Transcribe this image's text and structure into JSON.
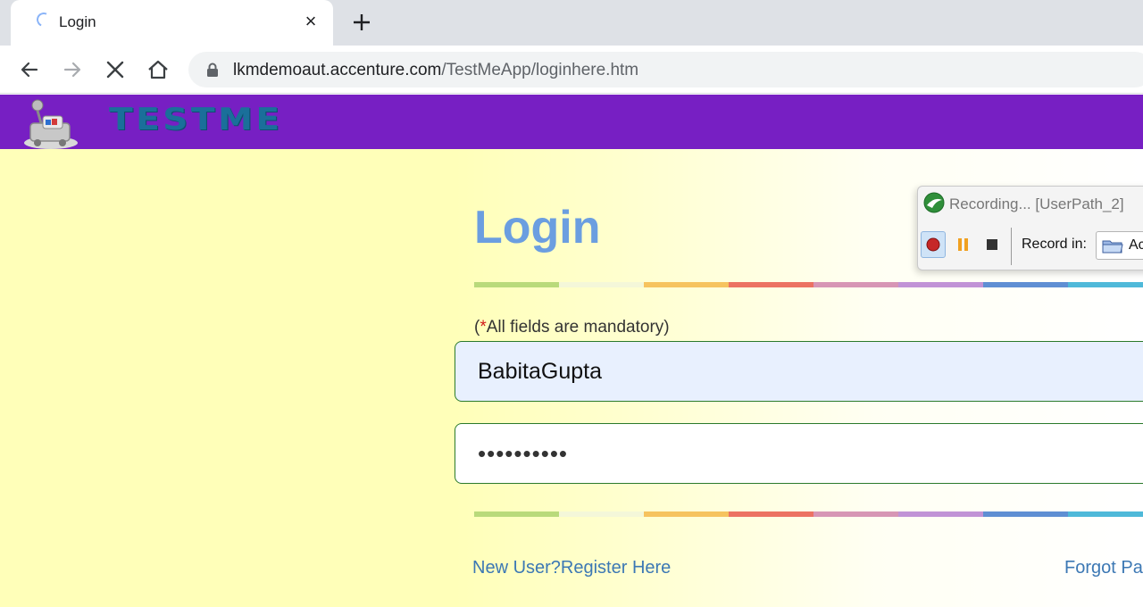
{
  "browser": {
    "tab_title": "Login",
    "tab_close": "×",
    "url_host": "lkmdemoaut.accenture.com",
    "url_path": "/TestMeApp/loginhere.htm"
  },
  "header": {
    "logo_text": "TESTME"
  },
  "login": {
    "title": "Login",
    "mandatory_open": "(",
    "mandatory_star": "*",
    "mandatory_rest": "All fields are mandatory)",
    "username_value": "BabitaGupta",
    "password_mask": "••••••••••",
    "register_link": "New User?Register Here",
    "forgot_link": "Forgot Pa"
  },
  "rainbow_colors": [
    "#b9da7b",
    "#f4f7d9",
    "#f6c35f",
    "#ec7263",
    "#d796b5",
    "#c193d6",
    "#5f8fd3",
    "#4fb9d9"
  ],
  "recorder": {
    "title": "Recording... [UserPath_2]",
    "record_in_label": "Record in:",
    "record_in_value": "Ac"
  },
  "colors": {
    "header_bg": "#771fc3",
    "title_color": "#6b9ee0",
    "link_color": "#3c78b4"
  }
}
